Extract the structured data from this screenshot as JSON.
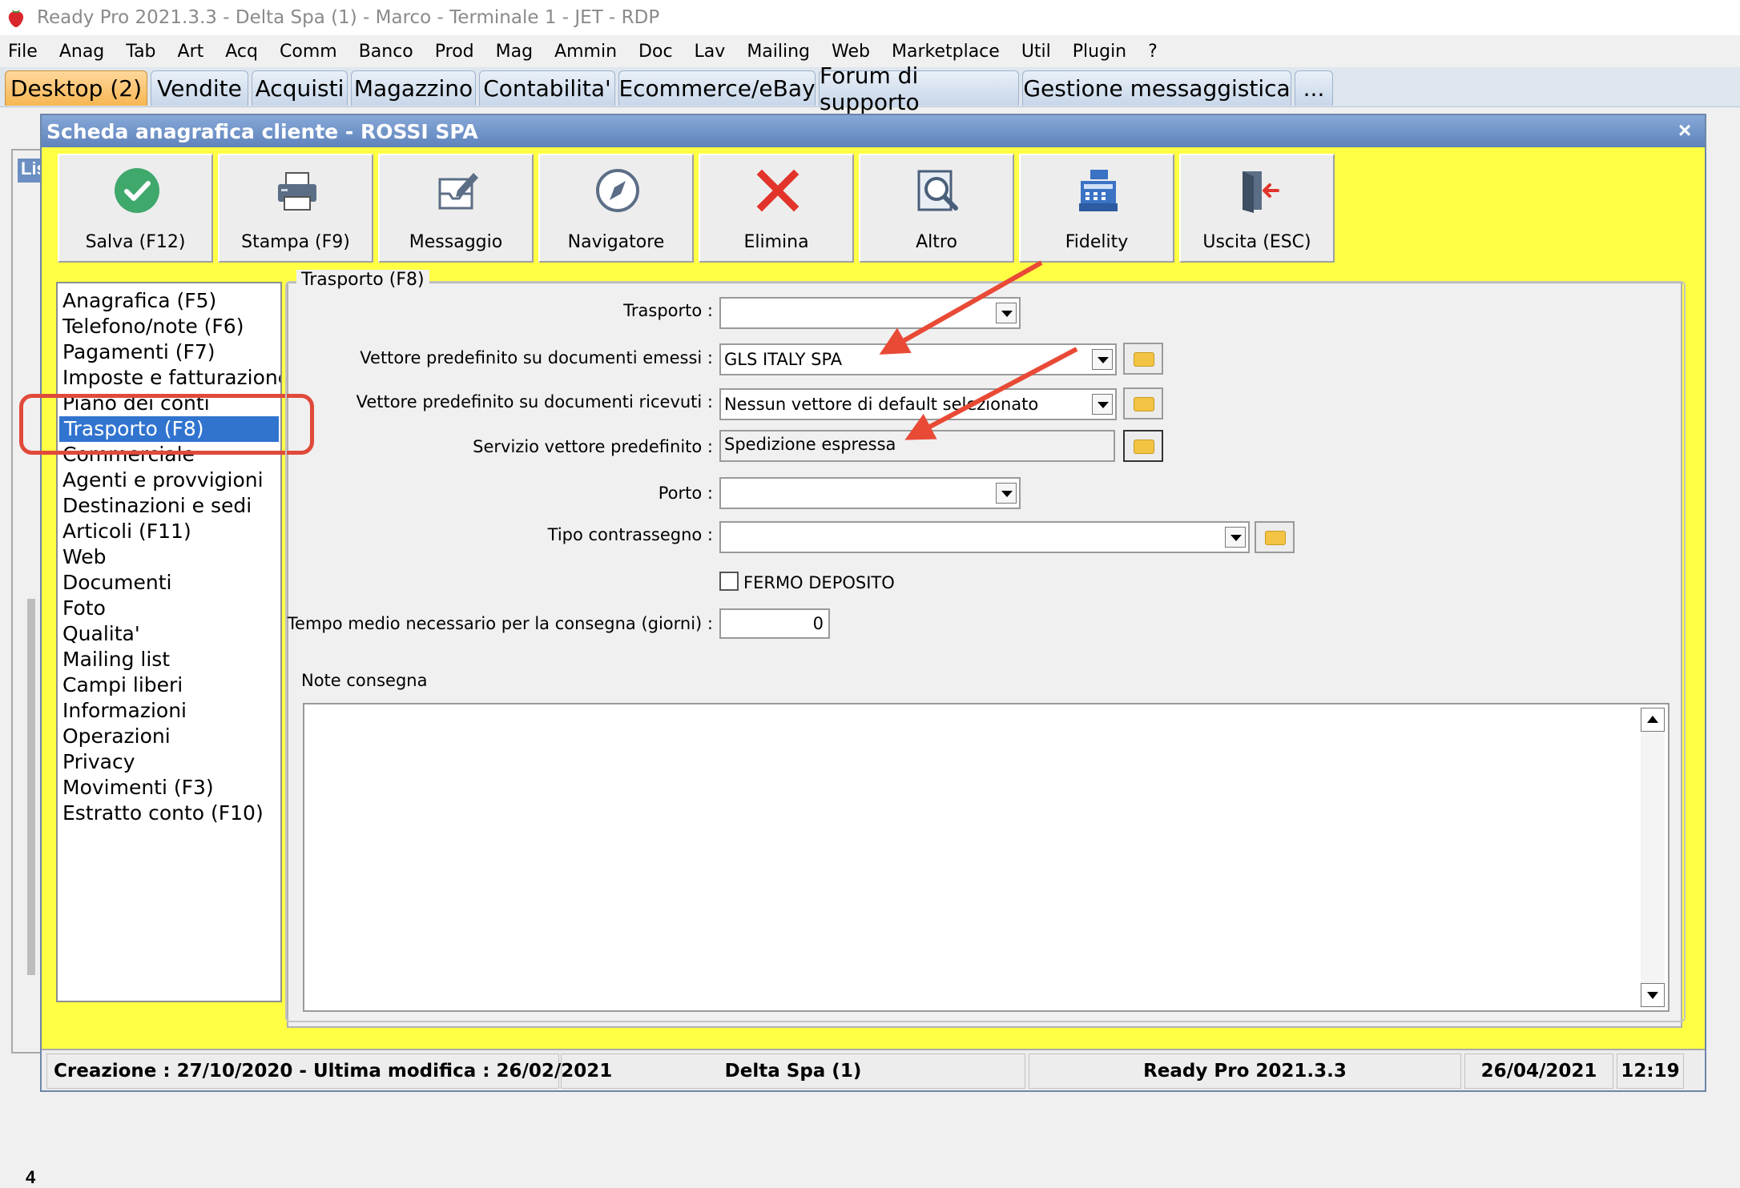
{
  "app_title": "Ready Pro 2021.3.3 - Delta Spa (1) - Marco - Terminale 1 - JET - RDP",
  "menu": [
    "File",
    "Anag",
    "Tab",
    "Art",
    "Acq",
    "Comm",
    "Banco",
    "Prod",
    "Mag",
    "Ammin",
    "Doc",
    "Lav",
    "Mailing",
    "Web",
    "Marketplace",
    "Util",
    "Plugin",
    "?"
  ],
  "tabs": [
    "Desktop (2)",
    "Vendite",
    "Acquisti",
    "Magazzino",
    "Contabilita'",
    "Ecommerce/eBay",
    "Forum di supporto",
    "Gestione messaggistica",
    "..."
  ],
  "background_window": {
    "header": "Lis",
    "left_number": "4"
  },
  "dialog": {
    "title": "Scheda anagrafica cliente - ROSSI SPA",
    "close": "×",
    "toolbar": [
      {
        "label": "Salva (F12)",
        "icon": "check-icon"
      },
      {
        "label": "Stampa (F9)",
        "icon": "printer-icon"
      },
      {
        "label": "Messaggio",
        "icon": "message-icon"
      },
      {
        "label": "Navigatore",
        "icon": "compass-icon"
      },
      {
        "label": "Elimina",
        "icon": "delete-x-icon"
      },
      {
        "label": "Altro",
        "icon": "search-document-icon"
      },
      {
        "label": "Fidelity",
        "icon": "cash-register-icon"
      },
      {
        "label": "Uscita (ESC)",
        "icon": "exit-door-icon"
      }
    ],
    "sidebar_items": [
      "Anagrafica (F5)",
      "Telefono/note (F6)",
      "Pagamenti (F7)",
      "Imposte e fatturazione",
      "Piano dei conti",
      "Trasporto (F8)",
      "Commerciale",
      "Agenti e provvigioni",
      "Destinazioni e sedi",
      "Articoli (F11)",
      "Web",
      "Documenti",
      "Foto",
      "Qualita'",
      "Mailing list",
      "Campi liberi",
      "Informazioni",
      "Operazioni",
      "Privacy",
      "Movimenti (F3)",
      "Estratto conto (F10)"
    ],
    "selected_sidebar": "Trasporto (F8)",
    "group_title": "Trasporto (F8)",
    "fields": {
      "trasporto_label": "Trasporto :",
      "trasporto_value": "",
      "vettore_emessi_label": "Vettore predefinito su documenti emessi :",
      "vettore_emessi_value": "GLS ITALY SPA",
      "vettore_ricevuti_label": "Vettore predefinito su documenti ricevuti :",
      "vettore_ricevuti_value": "Nessun vettore di default selezionato",
      "servizio_label": "Servizio vettore predefinito :",
      "servizio_value": "Spedizione espressa",
      "porto_label": "Porto :",
      "porto_value": "",
      "contrassegno_label": "Tipo contrassegno :",
      "contrassegno_value": "",
      "fermo_deposito_label": "FERMO DEPOSITO",
      "fermo_deposito_checked": false,
      "tempo_medio_label": "Tempo medio necessario per la consegna (giorni) :",
      "tempo_medio_value": "0",
      "note_label": "Note consegna",
      "note_value": ""
    }
  },
  "statusbar": {
    "dates": "Creazione : 27/10/2020 - Ultima modifica : 26/02/2021",
    "company": "Delta Spa (1)",
    "product": "Ready Pro 2021.3.3",
    "date": "26/04/2021",
    "time": "12:19"
  },
  "colors": {
    "dialog_bg": "#ffff44",
    "selection": "#3174d0",
    "annotation_red": "#e04a3a",
    "active_tab": "#f7b653"
  }
}
